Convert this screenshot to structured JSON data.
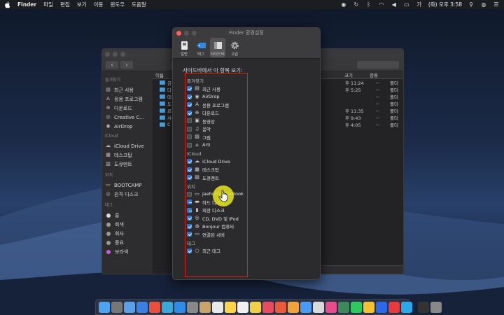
{
  "menubar": {
    "items": [
      "Finder",
      "파일",
      "편집",
      "보기",
      "이동",
      "윈도우",
      "도움말"
    ],
    "clock": "(화) 오후 3:58"
  },
  "finder_window": {
    "sidebar_sections": {
      "favorites": "즐겨찾기",
      "icloud": "iCloud",
      "locations": "위치",
      "tags": "태그"
    },
    "sidebar_favorites": [
      "최근 사용",
      "응용 프로그램",
      "다운로드",
      "Creative C...",
      "AirDrop"
    ],
    "sidebar_icloud": [
      "iCloud Drive",
      "데스크탑",
      "도큐멘트"
    ],
    "sidebar_locations": [
      "BOOTCAMP",
      "원격 디스크"
    ],
    "sidebar_tags": [
      {
        "name": "흉",
        "color": "#d8d8d8"
      },
      {
        "name": "회색",
        "color": "#9a9a9a"
      },
      {
        "name": "회사",
        "color": "#9a9a9a"
      },
      {
        "name": "중요",
        "color": "#9a9a9a"
      },
      {
        "name": "보라색",
        "color": "#c163d8"
      }
    ],
    "columns": {
      "name": "이름",
      "size": "크기",
      "kind": "종류"
    },
    "rows": [
      {
        "name": "금",
        "date": "후 11:24",
        "size": "--",
        "kind": "폴더"
      },
      {
        "name": "다",
        "date": "후 5:25",
        "size": "--",
        "kind": "폴더"
      },
      {
        "name": "데",
        "date": "",
        "size": "--",
        "kind": "폴더"
      },
      {
        "name": "도",
        "date": "",
        "size": "--",
        "kind": "폴더"
      },
      {
        "name": "르",
        "date": "후 11:35",
        "size": "--",
        "kind": "폴더"
      },
      {
        "name": "사",
        "date": "후 9:43",
        "size": "--",
        "kind": "폴더"
      },
      {
        "name": "C",
        "date": "후 4:05",
        "size": "--",
        "kind": "폴더"
      }
    ],
    "status_text": "내컴"
  },
  "prefs_window": {
    "title": "Finder 환경설정",
    "tabs": [
      {
        "label": "일반",
        "icon": "general-icon",
        "active": false
      },
      {
        "label": "태그",
        "icon": "tag-icon",
        "active": false
      },
      {
        "label": "사이드바",
        "icon": "sidebar-icon",
        "active": true
      },
      {
        "label": "고급",
        "icon": "gear-icon",
        "active": false
      }
    ],
    "prompt": "사이드바에서 이 항목 보기:",
    "groups": [
      {
        "title": "즐겨찾기",
        "items": [
          {
            "label": "최근 사용",
            "checked": true,
            "icon": "recent-icon"
          },
          {
            "label": "AirDrop",
            "checked": true,
            "icon": "airdrop-icon"
          },
          {
            "label": "응용 프로그램",
            "checked": true,
            "icon": "apps-icon"
          },
          {
            "label": "다운로드",
            "checked": true,
            "icon": "download-icon"
          },
          {
            "label": "동영상",
            "checked": false,
            "icon": "movie-icon"
          },
          {
            "label": "음악",
            "checked": false,
            "icon": "music-icon"
          },
          {
            "label": "그림",
            "checked": false,
            "icon": "picture-icon"
          },
          {
            "label": "Arti",
            "checked": false,
            "icon": "home-icon"
          }
        ]
      },
      {
        "title": "iCloud",
        "items": [
          {
            "label": "iCloud Drive",
            "checked": true,
            "icon": "cloud-icon"
          },
          {
            "label": "데스크탑",
            "checked": true,
            "icon": "desktop-icon"
          },
          {
            "label": "도큐멘트",
            "checked": true,
            "icon": "document-icon"
          }
        ]
      },
      {
        "title": "위치",
        "items": [
          {
            "label": "jaehun's MacBook",
            "checked": false,
            "icon": "laptop-icon"
          },
          {
            "label": "하드 디스크",
            "checked": "mixed",
            "icon": "harddisk-icon"
          },
          {
            "label": "외장 디스크",
            "checked": "mixed",
            "icon": "external-disk-icon"
          },
          {
            "label": "CD, DVD 및 iPod",
            "checked": true,
            "icon": "disc-icon"
          },
          {
            "label": "Bonjour 컴퓨터",
            "checked": true,
            "icon": "bonjour-icon"
          },
          {
            "label": "연결된 서버",
            "checked": true,
            "icon": "server-icon"
          }
        ]
      },
      {
        "title": "태그",
        "items": [
          {
            "label": "최근 태그",
            "checked": true,
            "icon": "tag-circle-icon"
          }
        ]
      }
    ]
  },
  "dock": {
    "colors": [
      "#4da3f0",
      "#777",
      "#5aa0e8",
      "#3a80e0",
      "#e94f3a",
      "#3aa8d8",
      "#2f8be6",
      "#888",
      "#c8a46a",
      "#e8e8e8",
      "#ffd34a",
      "#f0f0f0",
      "#f2d046",
      "#e84a5f",
      "#e85a3a",
      "#f2a23a",
      "#4a9af2",
      "#d9d9d9",
      "#e74c8c",
      "#3a8a5a",
      "#2ec95c",
      "#f2c230",
      "#2a6ae8",
      "#e83a3a",
      "#2aa8e8",
      "#333",
      "#888"
    ]
  }
}
